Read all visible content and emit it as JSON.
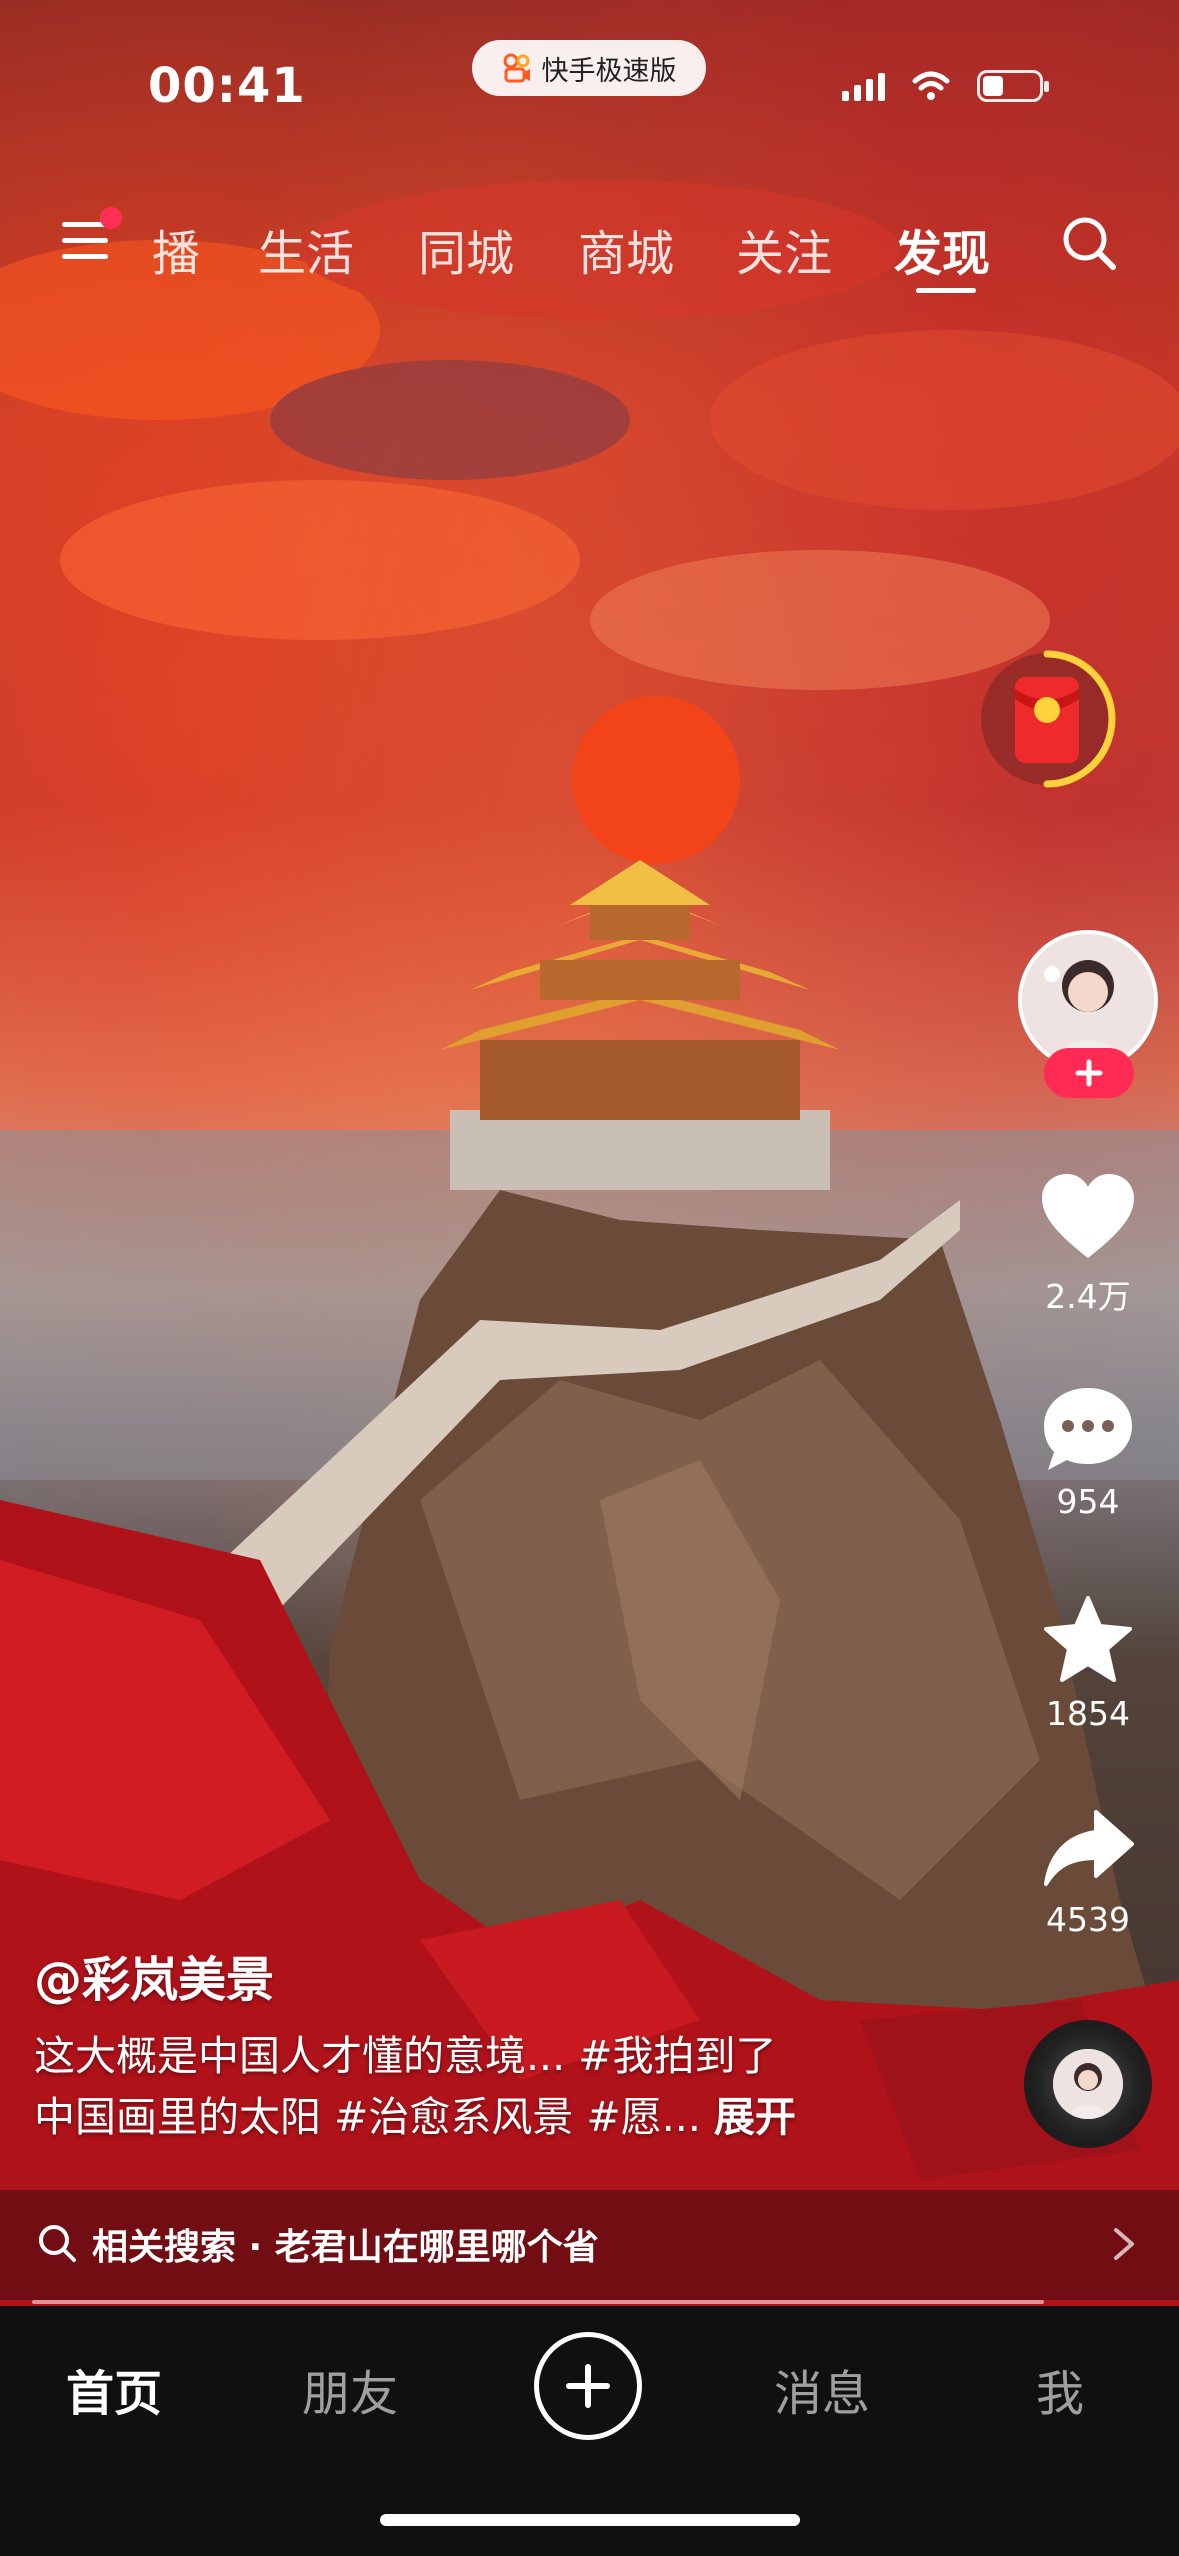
{
  "status_bar": {
    "time": "00:41",
    "app_pill_label": "快手极速版"
  },
  "top_nav": {
    "items": [
      "播",
      "生活",
      "同城",
      "商城",
      "关注",
      "发现"
    ],
    "active": "发现"
  },
  "sidebar": {
    "likes": "2.4万",
    "comments": "954",
    "favorites": "1854",
    "shares": "4539"
  },
  "video": {
    "author": "@彩岚美景",
    "caption_line1": "这大概是中国人才懂的意境... #我拍到了",
    "caption_line2": "中国画里的太阳 #治愈系风景 #愿... ",
    "expand_label": "展开"
  },
  "related_search": {
    "label": "相关搜索 · 老君山在哪里哪个省"
  },
  "tabbar": {
    "home": "首页",
    "friends": "朋友",
    "messages": "消息",
    "me": "我"
  },
  "colors": {
    "accent_red": "#ff2b54",
    "tabbar_bg": "#101010",
    "packet_ring": "#ffd23c"
  }
}
